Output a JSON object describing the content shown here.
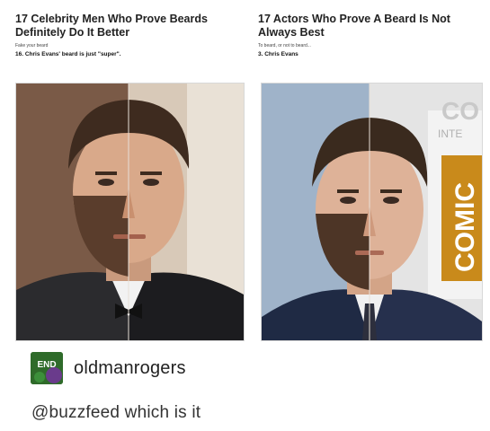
{
  "left_article": {
    "title": "17 Celebrity Men Who Prove Beards Definitely Do It Better",
    "subtitle": "Fake your beard",
    "item": "16. Chris Evans' beard is just \"super\"."
  },
  "right_article": {
    "title": "17 Actors Who Prove A Beard Is Not Always Best",
    "subtitle": "To beard, or not to beard...",
    "item": "3. Chris Evans"
  },
  "backdrop_text": {
    "comic": "COMIC",
    "con_fragment": "CO",
    "int_fragment": "INTE"
  },
  "post": {
    "avatar_text": "END",
    "username": "oldmanrogers",
    "comment": "@buzzfeed which is it"
  }
}
